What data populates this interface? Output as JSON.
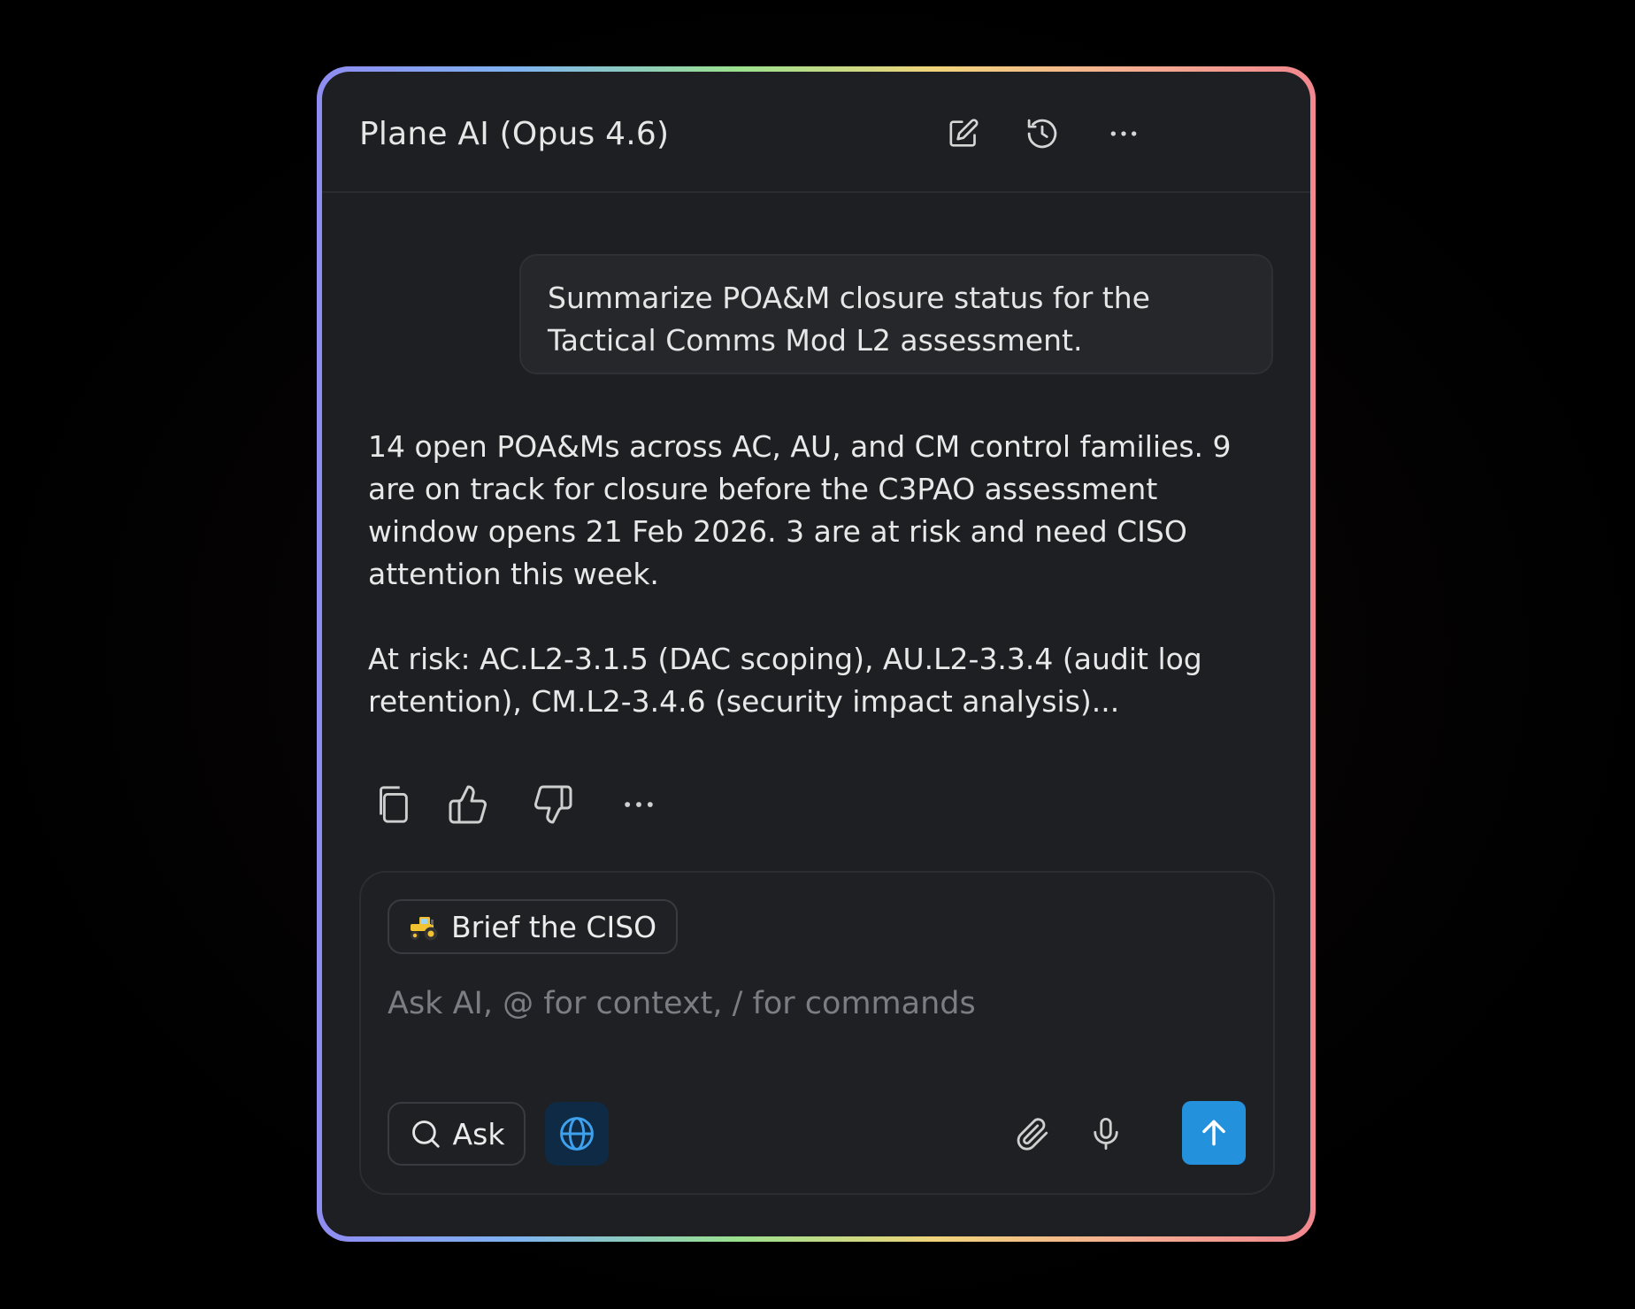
{
  "header": {
    "title": "Plane AI (Opus 4.6)",
    "icons": [
      "edit-icon",
      "history-icon",
      "more-icon"
    ]
  },
  "conversation": {
    "user_message": "Summarize POA&M closure status for the Tactical Comms Mod L2 assessment.",
    "assistant_reply": [
      "14 open POA&Ms across AC, AU, and CM control families. 9 are on track for closure before the C3PAO assessment window opens 21 Feb 2026. 3 are at risk and need CISO attention this week.",
      "At risk: AC.L2-3.1.5 (DAC scoping), AU.L2-3.3.4 (audit log retention), CM.L2-3.4.6 (security impact analysis)..."
    ],
    "actions": [
      "copy-icon",
      "thumbs-up-icon",
      "thumbs-down-icon",
      "more-icon"
    ]
  },
  "composer": {
    "chip_label": "Brief the CISO",
    "chip_icon": "tractor-emoji",
    "placeholder": "Ask AI, @ for context, / for commands",
    "value": "",
    "ask_label": "Ask",
    "send_icon": "arrow-up-icon"
  },
  "colors": {
    "background": "#000000",
    "panel": "#1e1f22",
    "accent": "#2391dc",
    "globe_bg": "#0f2a44"
  }
}
